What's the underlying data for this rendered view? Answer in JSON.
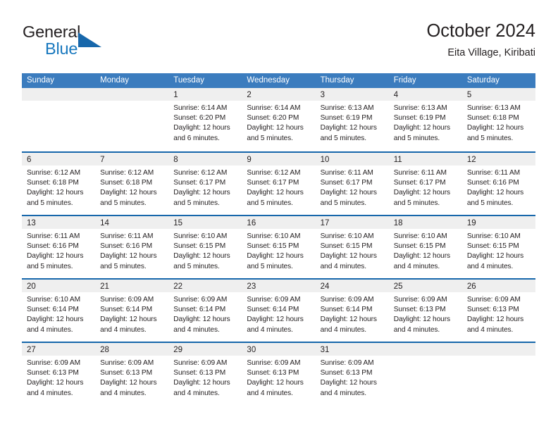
{
  "logo": {
    "word_one": "General",
    "word_two": "Blue",
    "triangle_color": "#1767ab",
    "blue_color": "#1878be"
  },
  "header": {
    "title": "October 2024",
    "subtitle": "Eita Village, Kiribati"
  },
  "theme": {
    "header_row_bg": "#3b7cbe",
    "week_divider": "#1767ab",
    "day_band_bg": "#efefef",
    "text": "#231f20"
  },
  "weekdays": [
    "Sunday",
    "Monday",
    "Tuesday",
    "Wednesday",
    "Thursday",
    "Friday",
    "Saturday"
  ],
  "weeks": [
    [
      {
        "day": "",
        "lines": []
      },
      {
        "day": "",
        "lines": []
      },
      {
        "day": "1",
        "lines": [
          "Sunrise: 6:14 AM",
          "Sunset: 6:20 PM",
          "Daylight: 12 hours",
          "and 6 minutes."
        ]
      },
      {
        "day": "2",
        "lines": [
          "Sunrise: 6:14 AM",
          "Sunset: 6:20 PM",
          "Daylight: 12 hours",
          "and 5 minutes."
        ]
      },
      {
        "day": "3",
        "lines": [
          "Sunrise: 6:13 AM",
          "Sunset: 6:19 PM",
          "Daylight: 12 hours",
          "and 5 minutes."
        ]
      },
      {
        "day": "4",
        "lines": [
          "Sunrise: 6:13 AM",
          "Sunset: 6:19 PM",
          "Daylight: 12 hours",
          "and 5 minutes."
        ]
      },
      {
        "day": "5",
        "lines": [
          "Sunrise: 6:13 AM",
          "Sunset: 6:18 PM",
          "Daylight: 12 hours",
          "and 5 minutes."
        ]
      }
    ],
    [
      {
        "day": "6",
        "lines": [
          "Sunrise: 6:12 AM",
          "Sunset: 6:18 PM",
          "Daylight: 12 hours",
          "and 5 minutes."
        ]
      },
      {
        "day": "7",
        "lines": [
          "Sunrise: 6:12 AM",
          "Sunset: 6:18 PM",
          "Daylight: 12 hours",
          "and 5 minutes."
        ]
      },
      {
        "day": "8",
        "lines": [
          "Sunrise: 6:12 AM",
          "Sunset: 6:17 PM",
          "Daylight: 12 hours",
          "and 5 minutes."
        ]
      },
      {
        "day": "9",
        "lines": [
          "Sunrise: 6:12 AM",
          "Sunset: 6:17 PM",
          "Daylight: 12 hours",
          "and 5 minutes."
        ]
      },
      {
        "day": "10",
        "lines": [
          "Sunrise: 6:11 AM",
          "Sunset: 6:17 PM",
          "Daylight: 12 hours",
          "and 5 minutes."
        ]
      },
      {
        "day": "11",
        "lines": [
          "Sunrise: 6:11 AM",
          "Sunset: 6:17 PM",
          "Daylight: 12 hours",
          "and 5 minutes."
        ]
      },
      {
        "day": "12",
        "lines": [
          "Sunrise: 6:11 AM",
          "Sunset: 6:16 PM",
          "Daylight: 12 hours",
          "and 5 minutes."
        ]
      }
    ],
    [
      {
        "day": "13",
        "lines": [
          "Sunrise: 6:11 AM",
          "Sunset: 6:16 PM",
          "Daylight: 12 hours",
          "and 5 minutes."
        ]
      },
      {
        "day": "14",
        "lines": [
          "Sunrise: 6:11 AM",
          "Sunset: 6:16 PM",
          "Daylight: 12 hours",
          "and 5 minutes."
        ]
      },
      {
        "day": "15",
        "lines": [
          "Sunrise: 6:10 AM",
          "Sunset: 6:15 PM",
          "Daylight: 12 hours",
          "and 5 minutes."
        ]
      },
      {
        "day": "16",
        "lines": [
          "Sunrise: 6:10 AM",
          "Sunset: 6:15 PM",
          "Daylight: 12 hours",
          "and 5 minutes."
        ]
      },
      {
        "day": "17",
        "lines": [
          "Sunrise: 6:10 AM",
          "Sunset: 6:15 PM",
          "Daylight: 12 hours",
          "and 4 minutes."
        ]
      },
      {
        "day": "18",
        "lines": [
          "Sunrise: 6:10 AM",
          "Sunset: 6:15 PM",
          "Daylight: 12 hours",
          "and 4 minutes."
        ]
      },
      {
        "day": "19",
        "lines": [
          "Sunrise: 6:10 AM",
          "Sunset: 6:15 PM",
          "Daylight: 12 hours",
          "and 4 minutes."
        ]
      }
    ],
    [
      {
        "day": "20",
        "lines": [
          "Sunrise: 6:10 AM",
          "Sunset: 6:14 PM",
          "Daylight: 12 hours",
          "and 4 minutes."
        ]
      },
      {
        "day": "21",
        "lines": [
          "Sunrise: 6:09 AM",
          "Sunset: 6:14 PM",
          "Daylight: 12 hours",
          "and 4 minutes."
        ]
      },
      {
        "day": "22",
        "lines": [
          "Sunrise: 6:09 AM",
          "Sunset: 6:14 PM",
          "Daylight: 12 hours",
          "and 4 minutes."
        ]
      },
      {
        "day": "23",
        "lines": [
          "Sunrise: 6:09 AM",
          "Sunset: 6:14 PM",
          "Daylight: 12 hours",
          "and 4 minutes."
        ]
      },
      {
        "day": "24",
        "lines": [
          "Sunrise: 6:09 AM",
          "Sunset: 6:14 PM",
          "Daylight: 12 hours",
          "and 4 minutes."
        ]
      },
      {
        "day": "25",
        "lines": [
          "Sunrise: 6:09 AM",
          "Sunset: 6:13 PM",
          "Daylight: 12 hours",
          "and 4 minutes."
        ]
      },
      {
        "day": "26",
        "lines": [
          "Sunrise: 6:09 AM",
          "Sunset: 6:13 PM",
          "Daylight: 12 hours",
          "and 4 minutes."
        ]
      }
    ],
    [
      {
        "day": "27",
        "lines": [
          "Sunrise: 6:09 AM",
          "Sunset: 6:13 PM",
          "Daylight: 12 hours",
          "and 4 minutes."
        ]
      },
      {
        "day": "28",
        "lines": [
          "Sunrise: 6:09 AM",
          "Sunset: 6:13 PM",
          "Daylight: 12 hours",
          "and 4 minutes."
        ]
      },
      {
        "day": "29",
        "lines": [
          "Sunrise: 6:09 AM",
          "Sunset: 6:13 PM",
          "Daylight: 12 hours",
          "and 4 minutes."
        ]
      },
      {
        "day": "30",
        "lines": [
          "Sunrise: 6:09 AM",
          "Sunset: 6:13 PM",
          "Daylight: 12 hours",
          "and 4 minutes."
        ]
      },
      {
        "day": "31",
        "lines": [
          "Sunrise: 6:09 AM",
          "Sunset: 6:13 PM",
          "Daylight: 12 hours",
          "and 4 minutes."
        ]
      },
      {
        "day": "",
        "lines": []
      },
      {
        "day": "",
        "lines": []
      }
    ]
  ]
}
